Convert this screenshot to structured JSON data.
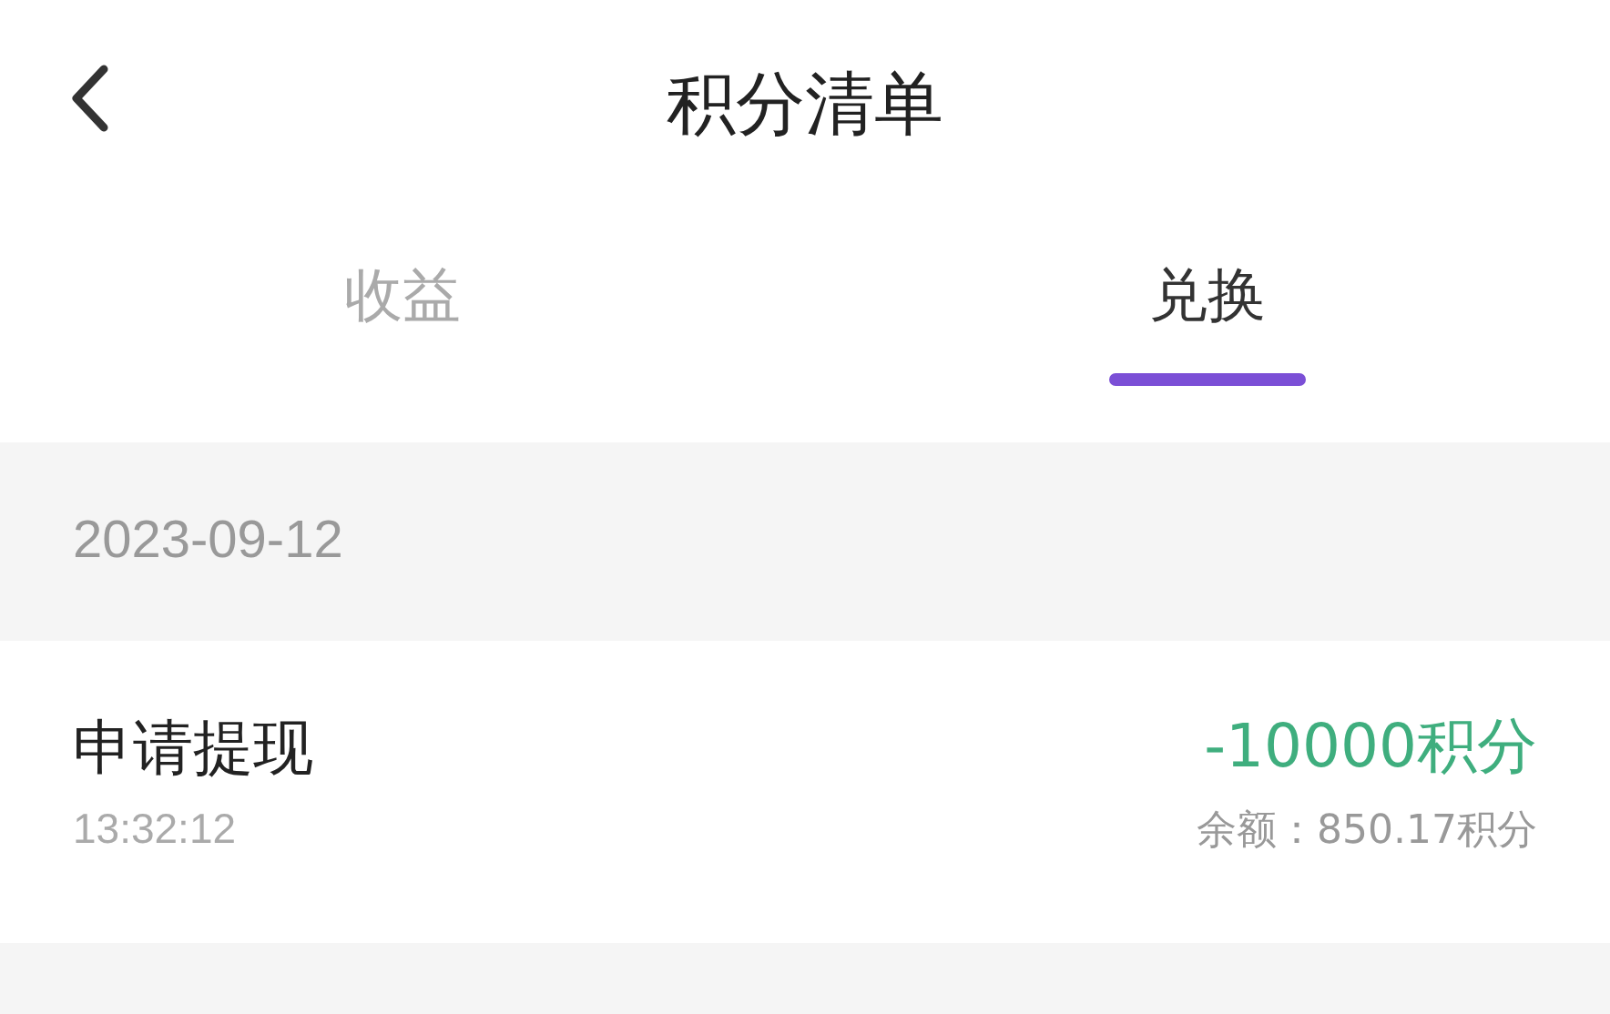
{
  "header": {
    "title": "积分清单"
  },
  "tabs": [
    {
      "label": "收益",
      "selected": false
    },
    {
      "label": "兑换",
      "selected": true
    }
  ],
  "groups": [
    {
      "date": "2023-09-12",
      "records": [
        {
          "title": "申请提现",
          "time": "13:32:12",
          "amount": "-10000积分",
          "balance": "余额：850.17积分"
        }
      ]
    }
  ]
}
